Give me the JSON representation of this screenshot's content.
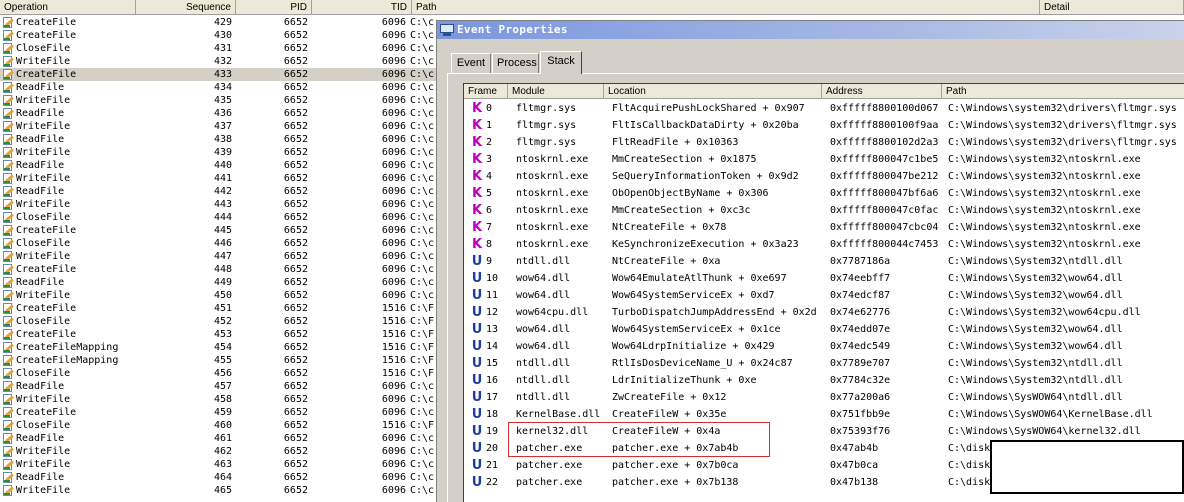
{
  "background_list": {
    "columns": {
      "operation": "Operation",
      "sequence": "Sequence",
      "pid": "PID",
      "tid": "TID",
      "path": "Path",
      "detail": "Detail"
    },
    "rows": [
      {
        "op": "CreateFile",
        "seq": "429",
        "pid": "6652",
        "tid": "6096",
        "path": "C:\\c"
      },
      {
        "op": "CreateFile",
        "seq": "430",
        "pid": "6652",
        "tid": "6096",
        "path": "C:\\c"
      },
      {
        "op": "CloseFile",
        "seq": "431",
        "pid": "6652",
        "tid": "6096",
        "path": "C:\\c"
      },
      {
        "op": "WriteFile",
        "seq": "432",
        "pid": "6652",
        "tid": "6096",
        "path": "C:\\c"
      },
      {
        "op": "CreateFile",
        "seq": "433",
        "pid": "6652",
        "tid": "6096",
        "path": "C:\\c",
        "selected": true
      },
      {
        "op": "ReadFile",
        "seq": "434",
        "pid": "6652",
        "tid": "6096",
        "path": "C:\\c"
      },
      {
        "op": "WriteFile",
        "seq": "435",
        "pid": "6652",
        "tid": "6096",
        "path": "C:\\c"
      },
      {
        "op": "ReadFile",
        "seq": "436",
        "pid": "6652",
        "tid": "6096",
        "path": "C:\\c"
      },
      {
        "op": "WriteFile",
        "seq": "437",
        "pid": "6652",
        "tid": "6096",
        "path": "C:\\c"
      },
      {
        "op": "ReadFile",
        "seq": "438",
        "pid": "6652",
        "tid": "6096",
        "path": "C:\\c"
      },
      {
        "op": "WriteFile",
        "seq": "439",
        "pid": "6652",
        "tid": "6096",
        "path": "C:\\c"
      },
      {
        "op": "ReadFile",
        "seq": "440",
        "pid": "6652",
        "tid": "6096",
        "path": "C:\\c"
      },
      {
        "op": "WriteFile",
        "seq": "441",
        "pid": "6652",
        "tid": "6096",
        "path": "C:\\c"
      },
      {
        "op": "ReadFile",
        "seq": "442",
        "pid": "6652",
        "tid": "6096",
        "path": "C:\\c"
      },
      {
        "op": "WriteFile",
        "seq": "443",
        "pid": "6652",
        "tid": "6096",
        "path": "C:\\c"
      },
      {
        "op": "CloseFile",
        "seq": "444",
        "pid": "6652",
        "tid": "6096",
        "path": "C:\\c"
      },
      {
        "op": "CreateFile",
        "seq": "445",
        "pid": "6652",
        "tid": "6096",
        "path": "C:\\c"
      },
      {
        "op": "CloseFile",
        "seq": "446",
        "pid": "6652",
        "tid": "6096",
        "path": "C:\\c"
      },
      {
        "op": "WriteFile",
        "seq": "447",
        "pid": "6652",
        "tid": "6096",
        "path": "C:\\c"
      },
      {
        "op": "CreateFile",
        "seq": "448",
        "pid": "6652",
        "tid": "6096",
        "path": "C:\\c"
      },
      {
        "op": "ReadFile",
        "seq": "449",
        "pid": "6652",
        "tid": "6096",
        "path": "C:\\c"
      },
      {
        "op": "WriteFile",
        "seq": "450",
        "pid": "6652",
        "tid": "6096",
        "path": "C:\\c"
      },
      {
        "op": "CreateFile",
        "seq": "451",
        "pid": "6652",
        "tid": "1516",
        "path": "C:\\F"
      },
      {
        "op": "CloseFile",
        "seq": "452",
        "pid": "6652",
        "tid": "1516",
        "path": "C:\\F"
      },
      {
        "op": "CreateFile",
        "seq": "453",
        "pid": "6652",
        "tid": "1516",
        "path": "C:\\F"
      },
      {
        "op": "CreateFileMapping",
        "seq": "454",
        "pid": "6652",
        "tid": "1516",
        "path": "C:\\F"
      },
      {
        "op": "CreateFileMapping",
        "seq": "455",
        "pid": "6652",
        "tid": "1516",
        "path": "C:\\F"
      },
      {
        "op": "CloseFile",
        "seq": "456",
        "pid": "6652",
        "tid": "1516",
        "path": "C:\\F"
      },
      {
        "op": "ReadFile",
        "seq": "457",
        "pid": "6652",
        "tid": "6096",
        "path": "C:\\c"
      },
      {
        "op": "WriteFile",
        "seq": "458",
        "pid": "6652",
        "tid": "6096",
        "path": "C:\\c"
      },
      {
        "op": "CreateFile",
        "seq": "459",
        "pid": "6652",
        "tid": "6096",
        "path": "C:\\c"
      },
      {
        "op": "CloseFile",
        "seq": "460",
        "pid": "6652",
        "tid": "1516",
        "path": "C:\\F"
      },
      {
        "op": "ReadFile",
        "seq": "461",
        "pid": "6652",
        "tid": "6096",
        "path": "C:\\c"
      },
      {
        "op": "WriteFile",
        "seq": "462",
        "pid": "6652",
        "tid": "6096",
        "path": "C:\\c"
      },
      {
        "op": "WriteFile",
        "seq": "463",
        "pid": "6652",
        "tid": "6096",
        "path": "C:\\c"
      },
      {
        "op": "ReadFile",
        "seq": "464",
        "pid": "6652",
        "tid": "6096",
        "path": "C:\\c"
      },
      {
        "op": "WriteFile",
        "seq": "465",
        "pid": "6652",
        "tid": "6096",
        "path": "C:\\c"
      }
    ]
  },
  "dialog": {
    "title": "Event Properties",
    "tabs": [
      {
        "label": "Event",
        "active": false
      },
      {
        "label": "Process",
        "active": false
      },
      {
        "label": "Stack",
        "active": true
      }
    ]
  },
  "stack": {
    "columns": {
      "frame": "Frame",
      "module": "Module",
      "location": "Location",
      "address": "Address",
      "path": "Path"
    },
    "colors": {
      "kernel": "#c000c0",
      "user": "#1f3f9f"
    },
    "frames": [
      {
        "type": "K",
        "num": "0",
        "module": "fltmgr.sys",
        "location": "FltAcquirePushLockShared + 0x907",
        "address": "0xfffff8800100d067",
        "path": "C:\\Windows\\system32\\drivers\\fltmgr.sys"
      },
      {
        "type": "K",
        "num": "1",
        "module": "fltmgr.sys",
        "location": "FltIsCallbackDataDirty + 0x20ba",
        "address": "0xfffff8800100f9aa",
        "path": "C:\\Windows\\system32\\drivers\\fltmgr.sys"
      },
      {
        "type": "K",
        "num": "2",
        "module": "fltmgr.sys",
        "location": "FltReadFile + 0x10363",
        "address": "0xfffff8800102d2a3",
        "path": "C:\\Windows\\system32\\drivers\\fltmgr.sys"
      },
      {
        "type": "K",
        "num": "3",
        "module": "ntoskrnl.exe",
        "location": "MmCreateSection + 0x1875",
        "address": "0xfffff800047c1be5",
        "path": "C:\\Windows\\system32\\ntoskrnl.exe"
      },
      {
        "type": "K",
        "num": "4",
        "module": "ntoskrnl.exe",
        "location": "SeQueryInformationToken + 0x9d2",
        "address": "0xfffff800047be212",
        "path": "C:\\Windows\\system32\\ntoskrnl.exe"
      },
      {
        "type": "K",
        "num": "5",
        "module": "ntoskrnl.exe",
        "location": "ObOpenObjectByName + 0x306",
        "address": "0xfffff800047bf6a6",
        "path": "C:\\Windows\\system32\\ntoskrnl.exe"
      },
      {
        "type": "K",
        "num": "6",
        "module": "ntoskrnl.exe",
        "location": "MmCreateSection + 0xc3c",
        "address": "0xfffff800047c0fac",
        "path": "C:\\Windows\\system32\\ntoskrnl.exe"
      },
      {
        "type": "K",
        "num": "7",
        "module": "ntoskrnl.exe",
        "location": "NtCreateFile + 0x78",
        "address": "0xfffff800047cbc04",
        "path": "C:\\Windows\\system32\\ntoskrnl.exe"
      },
      {
        "type": "K",
        "num": "8",
        "module": "ntoskrnl.exe",
        "location": "KeSynchronizeExecution + 0x3a23",
        "address": "0xfffff800044c7453",
        "path": "C:\\Windows\\system32\\ntoskrnl.exe"
      },
      {
        "type": "U",
        "num": "9",
        "module": "ntdll.dll",
        "location": "NtCreateFile + 0xa",
        "address": "0x7787186a",
        "path": "C:\\Windows\\System32\\ntdll.dll"
      },
      {
        "type": "U",
        "num": "10",
        "module": "wow64.dll",
        "location": "Wow64EmulateAtlThunk + 0xe697",
        "address": "0x74eebff7",
        "path": "C:\\Windows\\System32\\wow64.dll"
      },
      {
        "type": "U",
        "num": "11",
        "module": "wow64.dll",
        "location": "Wow64SystemServiceEx + 0xd7",
        "address": "0x74edcf87",
        "path": "C:\\Windows\\System32\\wow64.dll"
      },
      {
        "type": "U",
        "num": "12",
        "module": "wow64cpu.dll",
        "location": "TurboDispatchJumpAddressEnd + 0x2d",
        "address": "0x74e62776",
        "path": "C:\\Windows\\System32\\wow64cpu.dll"
      },
      {
        "type": "U",
        "num": "13",
        "module": "wow64.dll",
        "location": "Wow64SystemServiceEx + 0x1ce",
        "address": "0x74edd07e",
        "path": "C:\\Windows\\System32\\wow64.dll"
      },
      {
        "type": "U",
        "num": "14",
        "module": "wow64.dll",
        "location": "Wow64LdrpInitialize + 0x429",
        "address": "0x74edc549",
        "path": "C:\\Windows\\System32\\wow64.dll"
      },
      {
        "type": "U",
        "num": "15",
        "module": "ntdll.dll",
        "location": "RtlIsDosDeviceName_U + 0x24c87",
        "address": "0x7789e707",
        "path": "C:\\Windows\\System32\\ntdll.dll"
      },
      {
        "type": "U",
        "num": "16",
        "module": "ntdll.dll",
        "location": "LdrInitializeThunk + 0xe",
        "address": "0x7784c32e",
        "path": "C:\\Windows\\System32\\ntdll.dll"
      },
      {
        "type": "U",
        "num": "17",
        "module": "ntdll.dll",
        "location": "ZwCreateFile + 0x12",
        "address": "0x77a200a6",
        "path": "C:\\Windows\\SysWOW64\\ntdll.dll"
      },
      {
        "type": "U",
        "num": "18",
        "module": "KernelBase.dll",
        "location": "CreateFileW + 0x35e",
        "address": "0x751fbb9e",
        "path": "C:\\Windows\\SysWOW64\\KernelBase.dll"
      },
      {
        "type": "U",
        "num": "19",
        "module": "kernel32.dll",
        "location": "CreateFileW + 0x4a",
        "address": "0x75393f76",
        "path": "C:\\Windows\\SysWOW64\\kernel32.dll"
      },
      {
        "type": "U",
        "num": "20",
        "module": "patcher.exe",
        "location": "patcher.exe + 0x7ab4b",
        "address": "0x47ab4b",
        "path": "C:\\disk"
      },
      {
        "type": "U",
        "num": "21",
        "module": "patcher.exe",
        "location": "patcher.exe + 0x7b0ca",
        "address": "0x47b0ca",
        "path": "C:\\disk"
      },
      {
        "type": "U",
        "num": "22",
        "module": "patcher.exe",
        "location": "patcher.exe + 0x7b138",
        "address": "0x47b138",
        "path": "C:\\disk"
      }
    ]
  }
}
